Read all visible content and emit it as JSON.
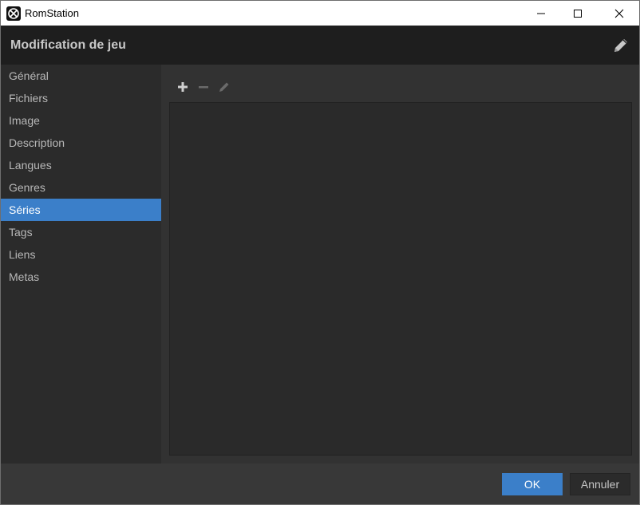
{
  "window": {
    "app_title": "RomStation"
  },
  "header": {
    "title": "Modification de jeu",
    "edit_icon": "pencil-icon"
  },
  "sidebar": {
    "items": [
      {
        "label": "Général"
      },
      {
        "label": "Fichiers"
      },
      {
        "label": "Image"
      },
      {
        "label": "Description"
      },
      {
        "label": "Langues"
      },
      {
        "label": "Genres"
      },
      {
        "label": "Séries",
        "active": true
      },
      {
        "label": "Tags"
      },
      {
        "label": "Liens"
      },
      {
        "label": "Metas"
      }
    ]
  },
  "toolbar": {
    "add_icon": "plus-icon",
    "remove_icon": "minus-icon",
    "edit_icon": "pencil-icon"
  },
  "footer": {
    "ok_label": "OK",
    "cancel_label": "Annuler"
  },
  "colors": {
    "accent": "#3b7fc9",
    "header_bg": "#1e1e1e",
    "sidebar_bg": "#2b2b2b",
    "content_bg": "#323232"
  }
}
